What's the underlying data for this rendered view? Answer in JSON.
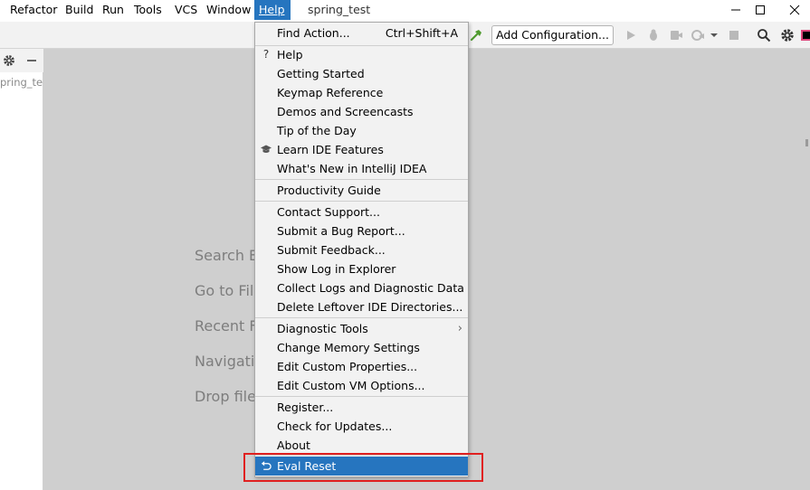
{
  "menubar": {
    "items": [
      {
        "label": "Refactor",
        "mnemonic": "R"
      },
      {
        "label": "Build",
        "mnemonic": "B"
      },
      {
        "label": "Run",
        "mnemonic": "u"
      },
      {
        "label": "Tools",
        "mnemonic": "T"
      },
      {
        "label": "VCS",
        "mnemonic": "S"
      },
      {
        "label": "Window",
        "mnemonic": "W"
      },
      {
        "label": "Help",
        "mnemonic": "H"
      }
    ],
    "project_title": "spring_test"
  },
  "toolbar": {
    "add_configuration_label": "Add Configuration..."
  },
  "side_panel": {
    "project_label": "spring_te"
  },
  "editor": {
    "hints": [
      "Search E",
      "Go to Fil",
      "Recent F",
      "Navigatio",
      "Drop file"
    ]
  },
  "help_menu": {
    "find_action": {
      "label": "Find Action...",
      "shortcut": "Ctrl+Shift+A"
    },
    "help": "Help",
    "getting_started": "Getting Started",
    "keymap_reference": "Keymap Reference",
    "demos": "Demos and Screencasts",
    "tip_of_day": "Tip of the Day",
    "learn_ide": "Learn IDE Features",
    "whats_new": "What's New in IntelliJ IDEA",
    "productivity_guide": "Productivity Guide",
    "contact_support": "Contact Support...",
    "submit_bug": "Submit a Bug Report...",
    "submit_feedback": "Submit Feedback...",
    "show_log": "Show Log in Explorer",
    "collect_logs": "Collect Logs and Diagnostic Data",
    "delete_leftover": "Delete Leftover IDE Directories...",
    "diagnostic_tools": "Diagnostic Tools",
    "change_memory": "Change Memory Settings",
    "edit_properties": "Edit Custom Properties...",
    "edit_vm_options": "Edit Custom VM Options...",
    "register": "Register...",
    "check_updates": "Check for Updates...",
    "about": "About",
    "eval_reset": "Eval Reset"
  },
  "icons": {
    "help_item": "?",
    "learn_item": "graduation-cap-icon",
    "eval_item": "undo-icon",
    "submenu_arrow": "›"
  },
  "colors": {
    "selection": "#2675bf",
    "highlight_box": "#e02020",
    "editor_bg": "#cfcfcf"
  }
}
